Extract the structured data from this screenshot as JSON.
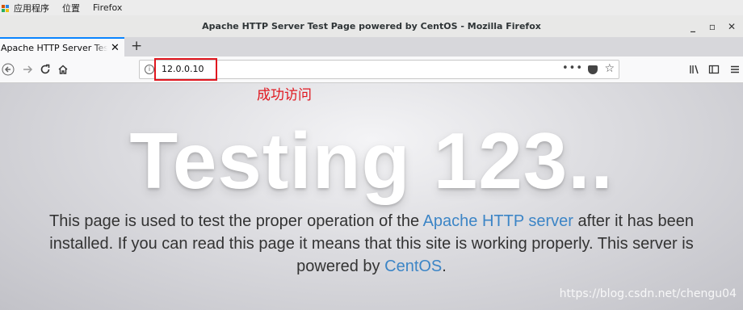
{
  "system_bar": {
    "apps": "应用程序",
    "places": "位置",
    "app_name": "Firefox"
  },
  "window": {
    "title": "Apache HTTP Server Test Page powered by CentOS - Mozilla Firefox"
  },
  "tabs": [
    {
      "label": "Apache HTTP Server Test Page"
    }
  ],
  "navbar": {
    "url": "12.0.0.10"
  },
  "annotation": "成功访问",
  "page": {
    "headline": "Testing 123..",
    "para_part1": "This page is used to test the proper operation of the ",
    "link_apache": "Apache HTTP server",
    "para_part2": " after it has been installed. If you can read this page it means that this site is working properly. This server is powered by ",
    "link_centos": "CentOS",
    "para_end": "."
  },
  "watermark": "https://blog.csdn.net/chengu04",
  "colors": {
    "accent": "#0a84ff",
    "highlight": "#e0171f",
    "link": "#3c85c6"
  }
}
